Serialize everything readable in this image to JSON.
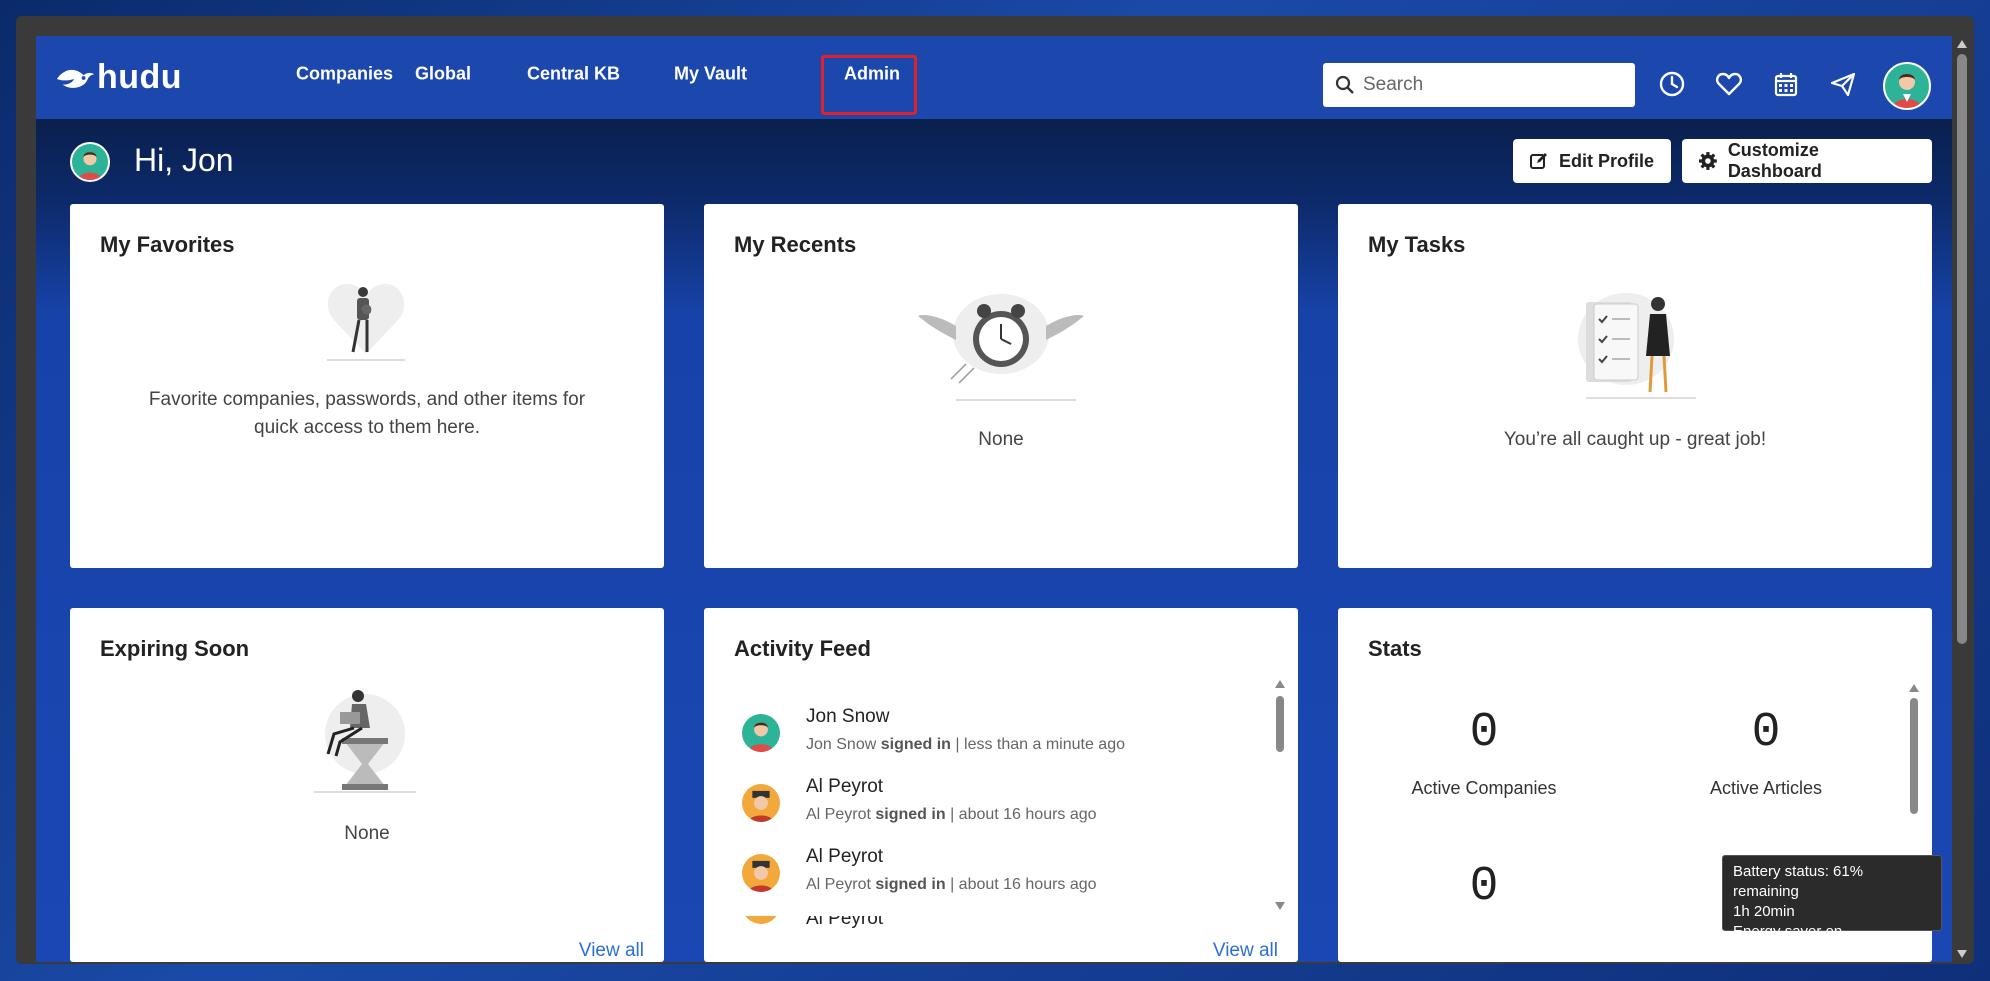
{
  "brand": {
    "name": "hudu"
  },
  "nav": {
    "items": [
      {
        "label": "Companies"
      },
      {
        "label": "Global"
      },
      {
        "label": "Central KB"
      },
      {
        "label": "My Vault"
      },
      {
        "label": "Admin"
      }
    ]
  },
  "search": {
    "placeholder": "Search"
  },
  "topbar_icons": [
    "clock-icon",
    "heart-icon",
    "calendar-icon",
    "paper-plane-icon"
  ],
  "header": {
    "greeting": "Hi, Jon",
    "edit_profile_label": "Edit Profile",
    "customize_label": "Customize Dashboard"
  },
  "cards": {
    "favorites": {
      "title": "My Favorites",
      "empty_line1": "Favorite companies, passwords, and other items for",
      "empty_line2": "quick access to them here."
    },
    "recents": {
      "title": "My Recents",
      "empty": "None"
    },
    "tasks": {
      "title": "My Tasks",
      "empty": "You’re all caught up - great job!"
    },
    "expiring": {
      "title": "Expiring Soon",
      "empty": "None",
      "view_all": "View all"
    },
    "activity": {
      "title": "Activity Feed",
      "view_all": "View all",
      "items": [
        {
          "name": "Jon Snow",
          "who": "Jon Snow",
          "action": "signed in",
          "when": "| less than a minute ago"
        },
        {
          "name": "Al Peyrot",
          "who": "Al Peyrot",
          "action": "signed in",
          "when": "| about 16 hours ago"
        },
        {
          "name": "Al Peyrot",
          "who": "Al Peyrot",
          "action": "signed in",
          "when": "| about 16 hours ago"
        },
        {
          "name": "Al Peyrot"
        }
      ]
    },
    "stats": {
      "title": "Stats",
      "items": [
        {
          "value": "0",
          "label": "Active Companies"
        },
        {
          "value": "0",
          "label": "Active Articles"
        },
        {
          "value": "0"
        }
      ]
    }
  },
  "tooltip": {
    "line1": "Battery status: 61% remaining",
    "line2": "1h 20min",
    "line3": "Energy saver on"
  },
  "colors": {
    "nav_bg": "#1c47ad",
    "accent_link": "#2a6fd6",
    "highlight_box": "#e0202a",
    "avatar_teal": "#2db398",
    "avatar_orange": "#f2a83b"
  }
}
